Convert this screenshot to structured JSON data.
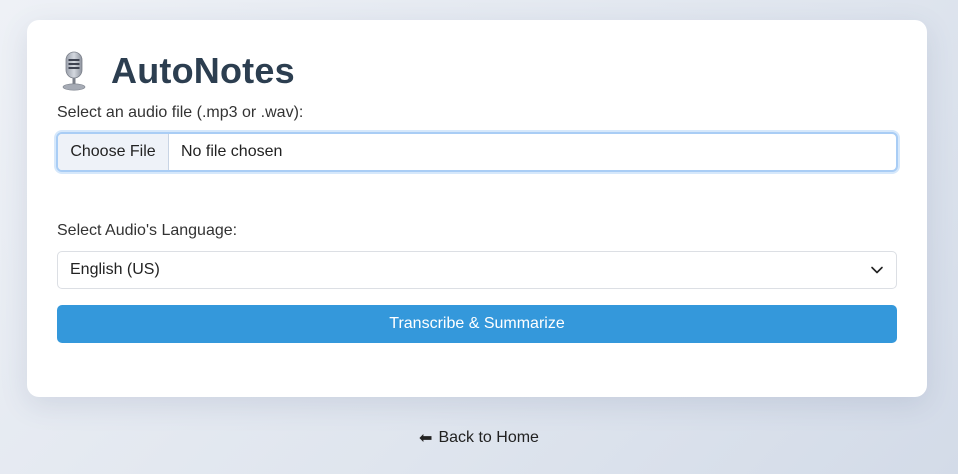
{
  "app": {
    "title": "AutoNotes",
    "icon": "microphone-icon"
  },
  "form": {
    "file_label": "Select an audio file (.mp3 or .wav):",
    "file_button": "Choose File",
    "file_status": "No file chosen",
    "language_label": "Select Audio's Language:",
    "language_selected": "English (US)",
    "submit_label": "Transcribe & Summarize"
  },
  "footer": {
    "back_icon": "arrow-left-icon",
    "back_label": "Back to Home"
  },
  "colors": {
    "primary": "#3498db",
    "title": "#2c3e50",
    "focus_border": "#a9cdf5"
  }
}
